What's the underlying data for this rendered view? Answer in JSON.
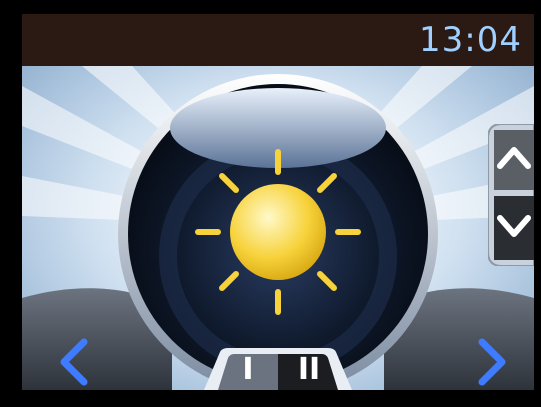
{
  "status_bar": {
    "time": "13:04"
  },
  "main_icon": {
    "name": "sun-icon",
    "meaning": "day mode"
  },
  "side_control": {
    "up_icon": "chevron-up-icon",
    "down_icon": "chevron-down-icon"
  },
  "navigation": {
    "left_icon": "chevron-left-icon",
    "right_icon": "chevron-right-icon"
  },
  "mode_tabs": [
    {
      "label": "I",
      "selected": true
    },
    {
      "label": "II",
      "selected": false
    }
  ],
  "colors": {
    "clock_text": "#9fd0ff",
    "sun_yellow": "#f7d23a",
    "nav_arrow_blue": "#3f7bff",
    "dial_dark": "#0b1220"
  }
}
